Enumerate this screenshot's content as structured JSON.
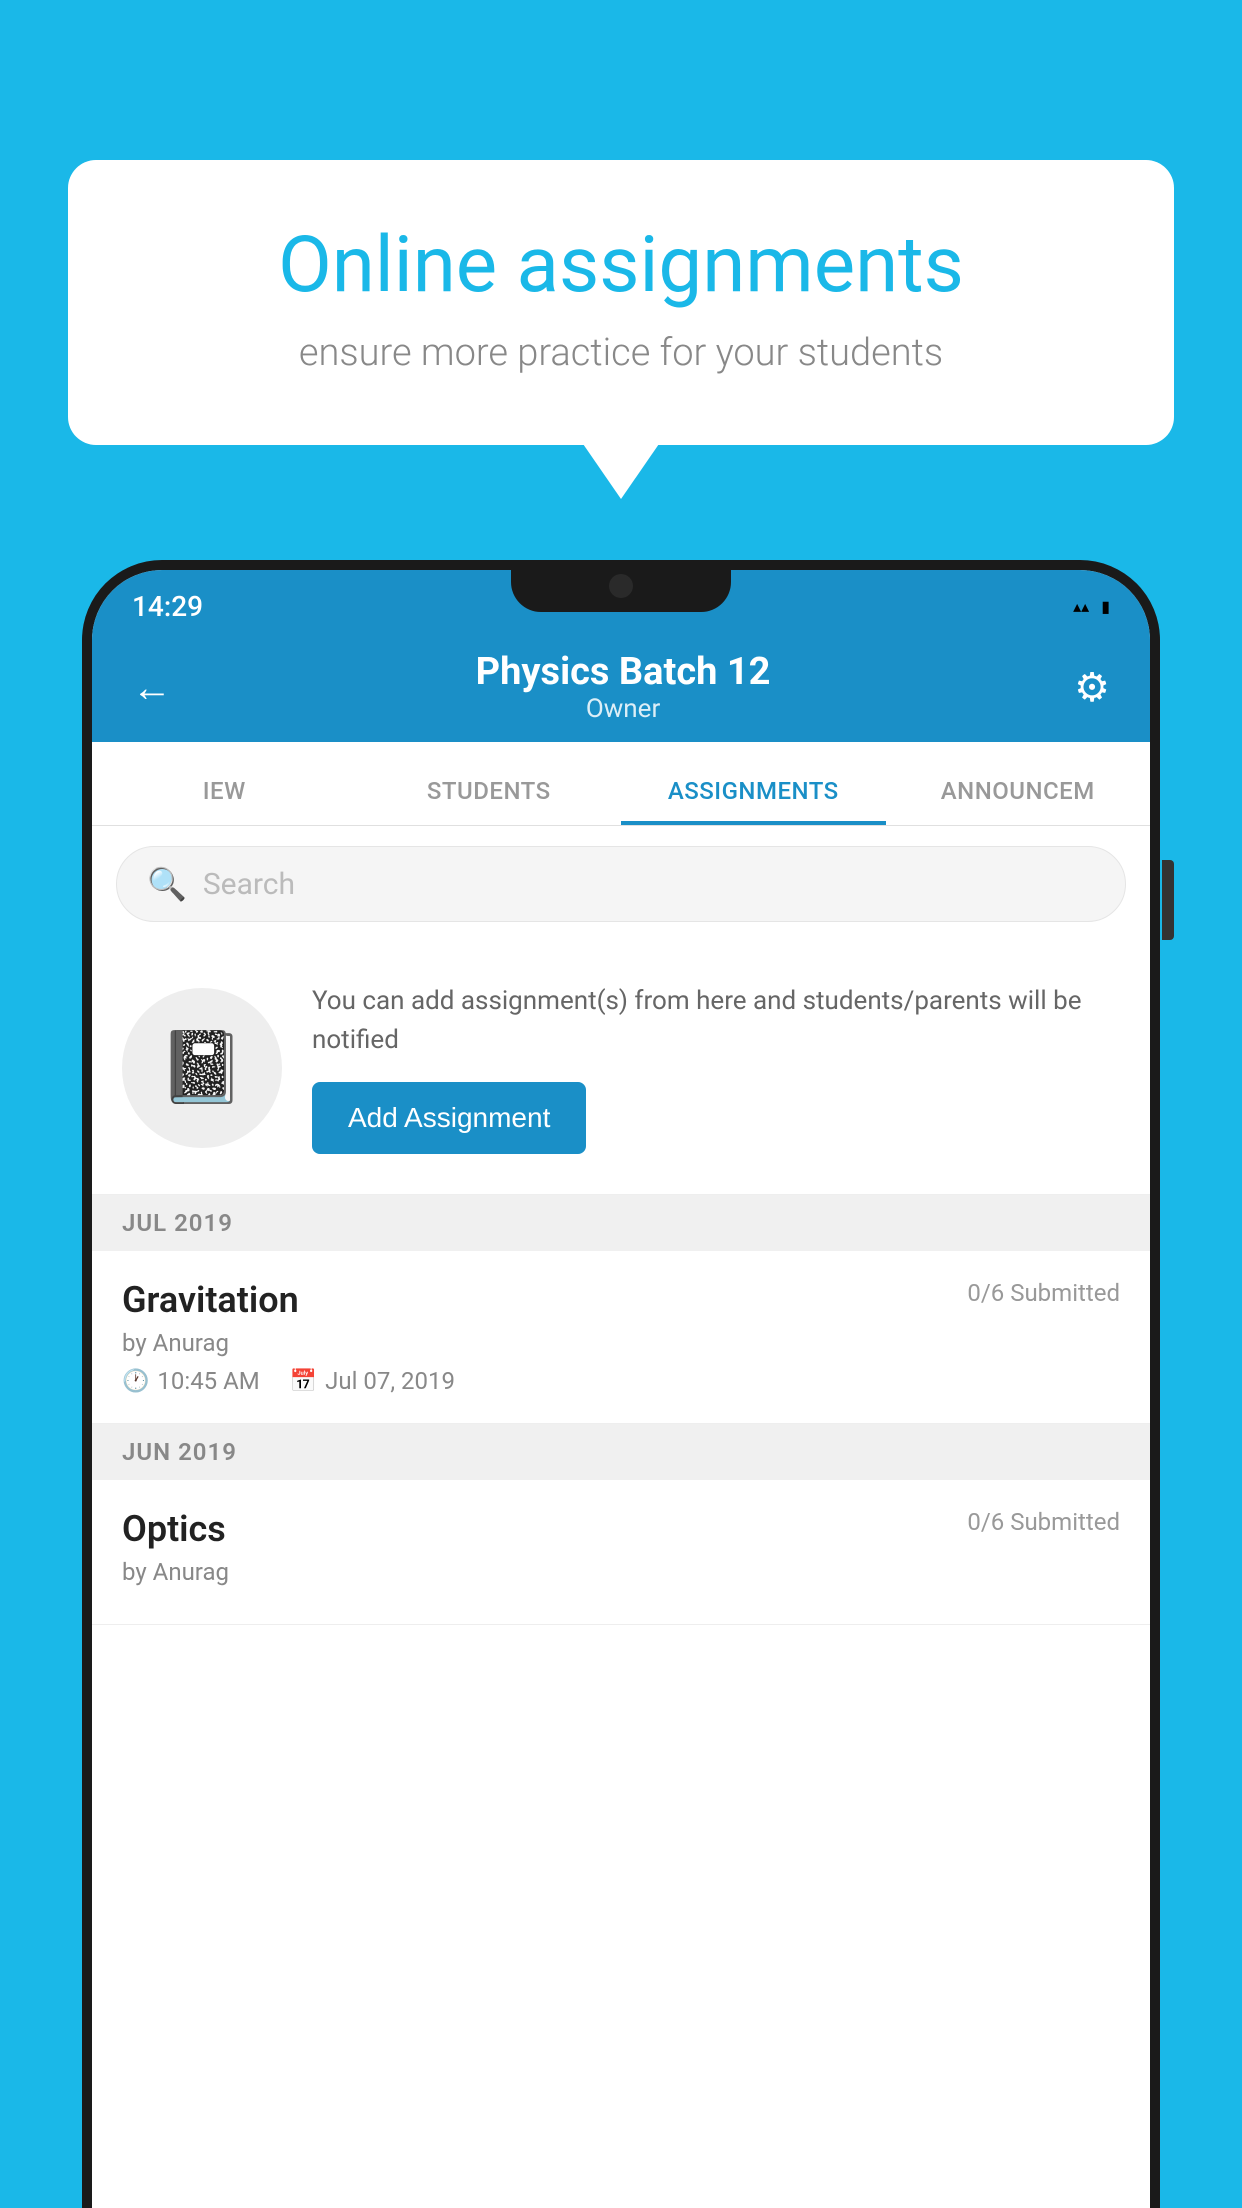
{
  "background_color": "#1ab8e8",
  "speech_bubble": {
    "title": "Online assignments",
    "subtitle": "ensure more practice for your students"
  },
  "status_bar": {
    "time": "14:29",
    "wifi_icon": "▲",
    "signal_icon": "▲",
    "battery_icon": "▮"
  },
  "app_header": {
    "title": "Physics Batch 12",
    "subtitle": "Owner",
    "back_label": "←",
    "settings_label": "⚙"
  },
  "tabs": [
    {
      "label": "IEW",
      "active": false
    },
    {
      "label": "STUDENTS",
      "active": false
    },
    {
      "label": "ASSIGNMENTS",
      "active": true
    },
    {
      "label": "ANNOUNCEM",
      "active": false
    }
  ],
  "search": {
    "placeholder": "Search"
  },
  "add_assignment_section": {
    "description": "You can add assignment(s) from here and students/parents will be notified",
    "button_label": "Add Assignment"
  },
  "sections": [
    {
      "header": "JUL 2019",
      "items": [
        {
          "name": "Gravitation",
          "submitted": "0/6 Submitted",
          "author": "by Anurag",
          "time": "10:45 AM",
          "date": "Jul 07, 2019"
        }
      ]
    },
    {
      "header": "JUN 2019",
      "items": [
        {
          "name": "Optics",
          "submitted": "0/6 Submitted",
          "author": "by Anurag",
          "time": "",
          "date": ""
        }
      ]
    }
  ]
}
